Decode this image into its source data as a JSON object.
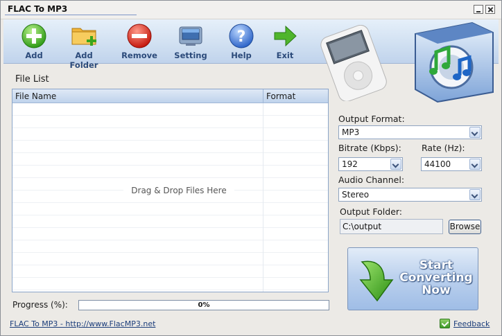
{
  "window": {
    "title": "FLAC To MP3"
  },
  "toolbar": {
    "buttons": [
      {
        "label": "Add",
        "icon": "add-icon"
      },
      {
        "label": "Add Folder",
        "icon": "add-folder-icon"
      },
      {
        "label": "Remove",
        "icon": "remove-icon"
      },
      {
        "label": "Setting",
        "icon": "setting-icon"
      },
      {
        "label": "Help",
        "icon": "help-icon"
      },
      {
        "label": "Exit",
        "icon": "exit-icon"
      }
    ]
  },
  "file_list": {
    "title": "File List",
    "columns": [
      "File Name",
      "Format"
    ],
    "rows": [],
    "empty_text": "Drag & Drop Files Here"
  },
  "progress": {
    "label": "Progress (%):",
    "value_text": "0%",
    "value": 0
  },
  "options": {
    "output_format": {
      "label": "Output Format:",
      "value": "MP3"
    },
    "bitrate": {
      "label": "Bitrate (Kbps):",
      "value": "192"
    },
    "rate": {
      "label": "Rate (Hz):",
      "value": "44100"
    },
    "audio_channel": {
      "label": "Audio Channel:",
      "value": "Stereo"
    },
    "output_folder": {
      "label": "Output Folder:",
      "value": "C:\\output",
      "browse_label": "Browse"
    }
  },
  "start_button": {
    "lines": [
      "Start",
      "Converting",
      "Now"
    ]
  },
  "footer": {
    "link_text": "FLAC To MP3 - http://www.FlacMP3.net",
    "feedback_label": "Feedback"
  },
  "colors": {
    "toolbar_bg": "#cfdff1",
    "start_button_bg": "#bdd2ee",
    "progress_fill": "#5a8ad0",
    "link": "#1b3d7a"
  }
}
